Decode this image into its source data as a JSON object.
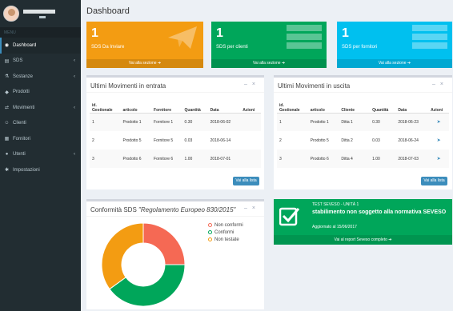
{
  "sidebar": {
    "nav_header": "MENU",
    "items": [
      {
        "label": "Dashboard",
        "icon": "dashboard-icon",
        "active": true
      },
      {
        "label": "SDS",
        "icon": "sds-icon",
        "chevron": true
      },
      {
        "label": "Sostanze",
        "icon": "flask-icon",
        "chevron": true
      },
      {
        "label": "Prodotti",
        "icon": "cube-icon",
        "chevron": false
      },
      {
        "label": "Movimenti",
        "icon": "exchange-icon",
        "chevron": true
      },
      {
        "label": "Clienti",
        "icon": "users-icon",
        "chevron": false
      },
      {
        "label": "Fornitori",
        "icon": "truck-icon",
        "chevron": false
      },
      {
        "label": "Utenti",
        "icon": "user-icon",
        "chevron": true
      },
      {
        "label": "Impostazioni",
        "icon": "gear-icon",
        "chevron": false
      }
    ]
  },
  "header": {
    "title": "Dashboard"
  },
  "info_boxes": [
    {
      "number": "1",
      "label": "SDS Da Inviare",
      "footer": "Vai alla sezione",
      "color": "#f39c12"
    },
    {
      "number": "1",
      "label": "SDS per clienti",
      "footer": "Vai alla sezione",
      "color": "#00a65a"
    },
    {
      "number": "1",
      "label": "SDS per fornitori",
      "footer": "Vai alla sezione",
      "color": "#00c0ef"
    }
  ],
  "movimenti_entrata": {
    "title": "Ultimi Movimenti in entrata",
    "columns": [
      "id. Gestionale",
      "articolo",
      "Fornitore",
      "Quantità",
      "Data",
      "Azioni"
    ],
    "rows": [
      [
        "1",
        "Prodotto 1",
        "Fornitore 1",
        "0.30",
        "2018-06-02"
      ],
      [
        "2",
        "Prodotto 5",
        "Fornitore 5",
        "0.03",
        "2018-06-14"
      ],
      [
        "3",
        "Prodotto 6",
        "Fornitore 6",
        "1.00",
        "2018-07-01"
      ]
    ],
    "button": "Vai alla lista"
  },
  "movimenti_uscita": {
    "title": "Ultimi Movimenti in uscita",
    "columns": [
      "id. Gestionale",
      "articolo",
      "Cliente",
      "Quantità",
      "Data",
      "Azioni"
    ],
    "rows": [
      [
        "1",
        "Prodotto 1",
        "Ditta 1",
        "0.30",
        "2018-06-23"
      ],
      [
        "2",
        "Prodotto 5",
        "Ditta 2",
        "0.03",
        "2018-06-24"
      ],
      [
        "3",
        "Prodotto 6",
        "Ditta 4",
        "1.00",
        "2018-07-03"
      ]
    ],
    "button": "Vai alla lista"
  },
  "conformita": {
    "title_prefix": "Conformità SDS",
    "title_italic": "\"Regolamento Europeo 830/2015\""
  },
  "seveso": {
    "head": "TEST SEVESO - UNITÀ 1",
    "main": "stabilimento non soggetto alla normativa SEVESO",
    "date": "Aggiornato al 15/06/2017",
    "footer": "Vai al report Seveso completo"
  },
  "chart_data": {
    "type": "pie",
    "categories": [
      "Non conformi",
      "Conformi",
      "Non testate"
    ],
    "values": [
      25,
      40,
      35
    ],
    "colors": [
      "#f56954",
      "#00a65a",
      "#f39c12"
    ],
    "legend_position": "right"
  }
}
